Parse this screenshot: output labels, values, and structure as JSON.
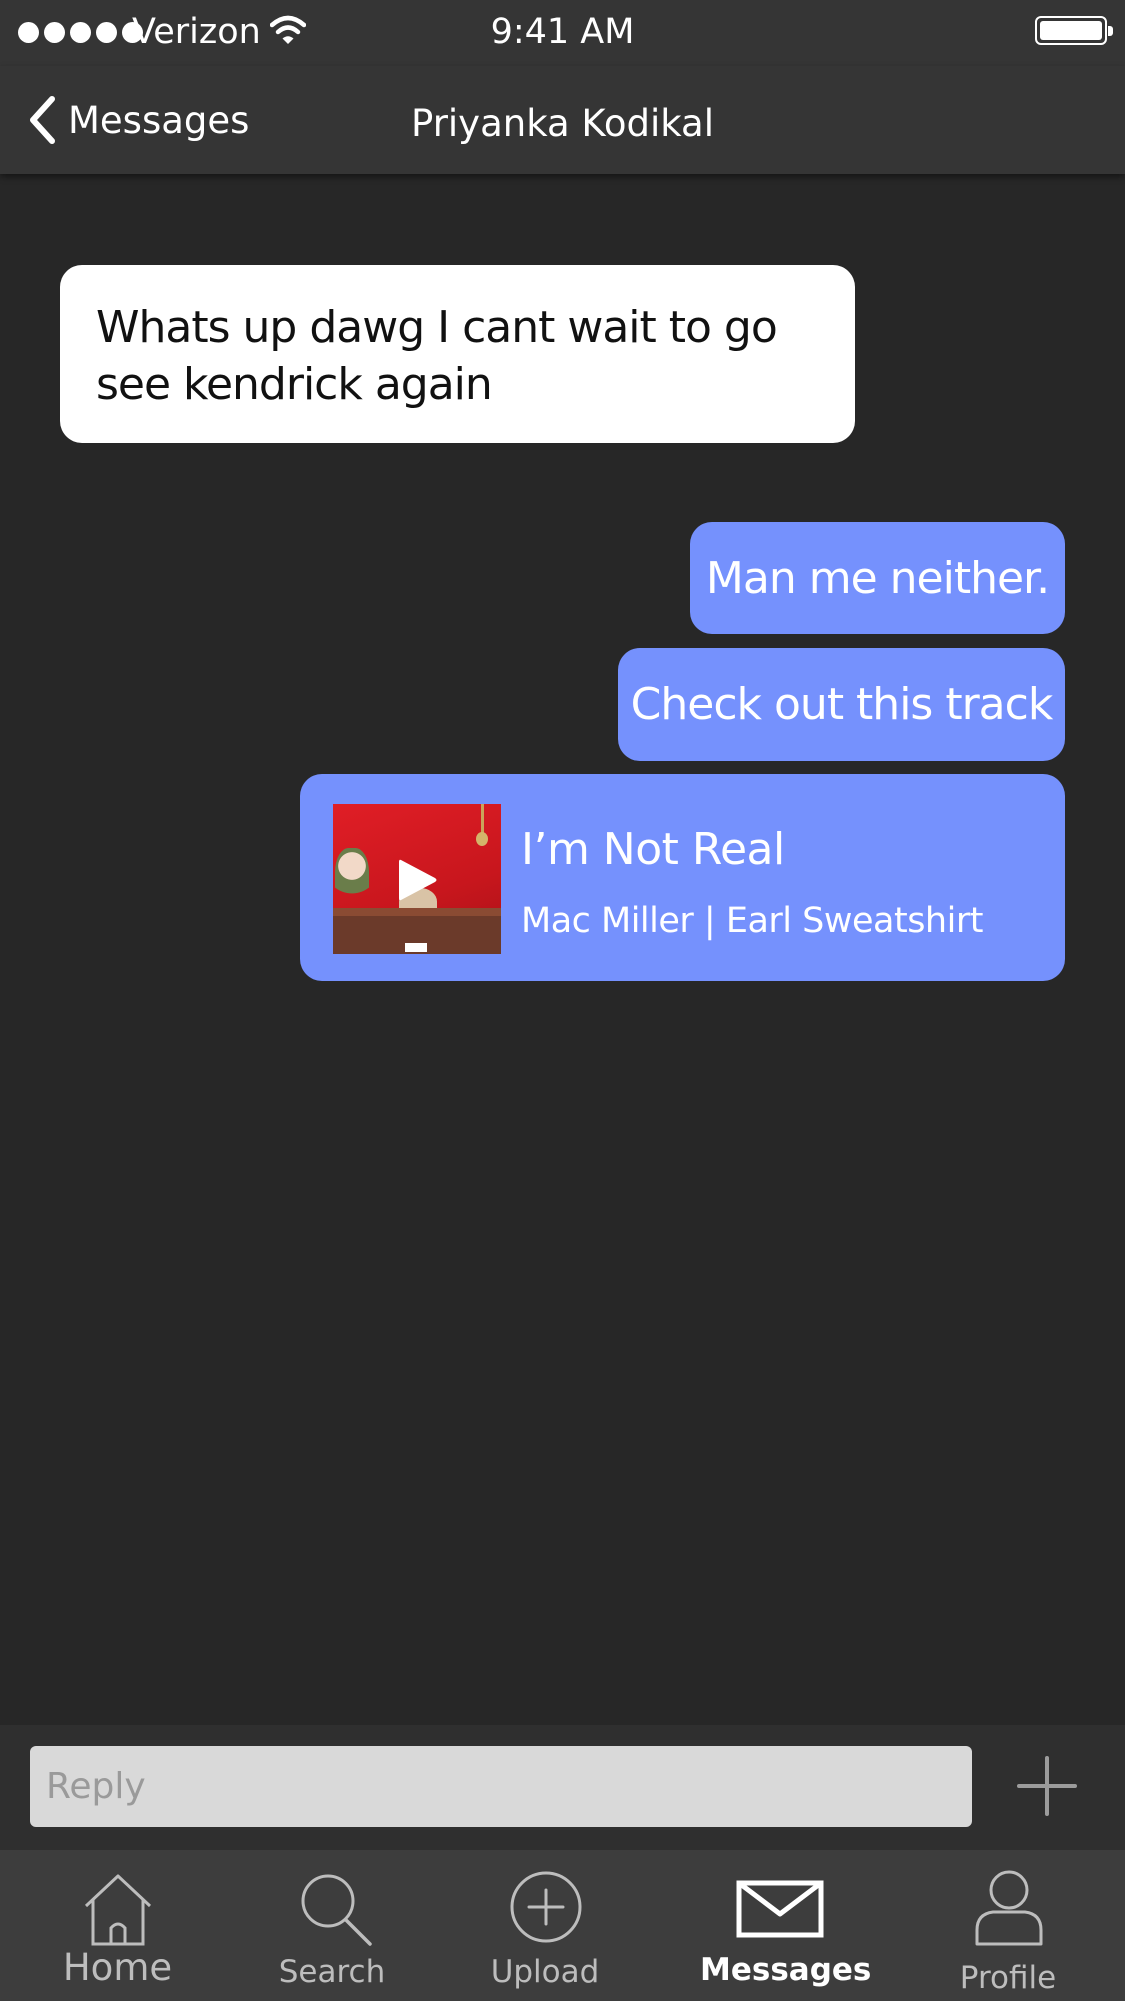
{
  "status_bar": {
    "carrier": "Verizon",
    "time": "9:41 AM",
    "icons": [
      "signal-dots-icon",
      "wifi-icon",
      "battery-icon"
    ]
  },
  "nav": {
    "back_label": "Messages",
    "title": "Priyanka Kodikal"
  },
  "messages": [
    {
      "direction": "incoming",
      "text": "Whats up dawg I cant wait to go see kendrick again"
    },
    {
      "direction": "outgoing",
      "text": "Man me neither."
    },
    {
      "direction": "outgoing",
      "text": "Check out this track"
    }
  ],
  "track": {
    "title": "I’m Not Real",
    "artists": "Mac Miller | Earl Sweatshirt",
    "icon": "play-icon"
  },
  "reply": {
    "placeholder": "Reply",
    "add_icon": "plus-icon"
  },
  "tabs": [
    {
      "label": "Home",
      "icon": "home-icon",
      "active": false
    },
    {
      "label": "Search",
      "icon": "search-icon",
      "active": false
    },
    {
      "label": "Upload",
      "icon": "upload-icon",
      "active": false
    },
    {
      "label": "Messages",
      "icon": "envelope-icon",
      "active": true
    },
    {
      "label": "Profile",
      "icon": "profile-icon",
      "active": false
    }
  ],
  "colors": {
    "background": "#272727",
    "bar": "#353535",
    "outgoing_bubble": "#7591fd",
    "incoming_bubble": "#ffffff",
    "tab_bar": "#3d3d3d"
  }
}
